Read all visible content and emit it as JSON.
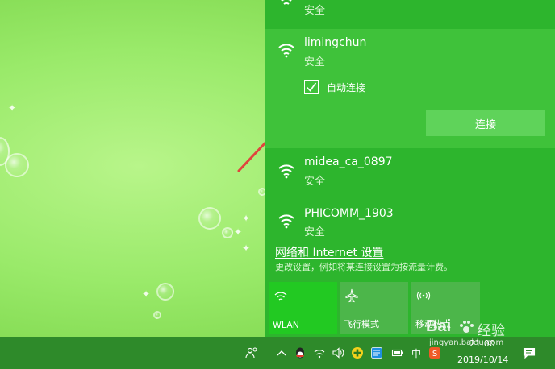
{
  "networks": [
    {
      "name": "",
      "status": "安全"
    },
    {
      "name": "limingchun",
      "status": "安全"
    },
    {
      "name": "midea_ca_0897",
      "status": "安全"
    },
    {
      "name": "PHICOMM_1903",
      "status": "安全"
    }
  ],
  "selected": {
    "auto_connect_label": "自动连接",
    "auto_connect_checked": true,
    "connect_label": "连接"
  },
  "settings": {
    "link": "网络和 Internet 设置",
    "description": "更改设置，例如将某连接设置为按流量计费。"
  },
  "quick_actions": [
    {
      "label": "WLAN",
      "icon": "wifi-icon",
      "active": true
    },
    {
      "label": "飞行模式",
      "icon": "airplane-icon",
      "active": false
    },
    {
      "label": "移动热点",
      "icon": "hotspot-icon",
      "active": false
    }
  ],
  "taskbar": {
    "input_method": "中",
    "time": "21:00",
    "date": "2019/10/14"
  },
  "watermark": {
    "brand": "Bai",
    "suffix": "经验",
    "url": "jingyan.baidu.com"
  },
  "colors": {
    "panel_bg": "#2db52d",
    "selected_bg": "#3fc23a",
    "tile_active": "#22c922",
    "tile_inactive": "#4cb64a",
    "taskbar_bg": "#2e8a2a",
    "arrow": "#e0453d"
  }
}
